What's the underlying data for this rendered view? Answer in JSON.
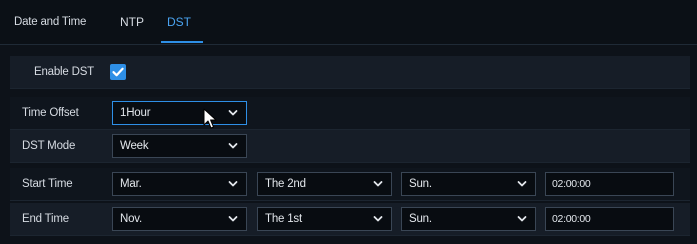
{
  "tabs": [
    {
      "label": "Date and Time",
      "active": false
    },
    {
      "label": "NTP",
      "active": false
    },
    {
      "label": "DST",
      "active": true
    }
  ],
  "accent_color": "#2e8fe6",
  "form": {
    "enable_dst": {
      "label": "Enable DST",
      "checked": true
    },
    "time_offset": {
      "label": "Time Offset",
      "value": "1Hour"
    },
    "dst_mode": {
      "label": "DST Mode",
      "value": "Week"
    },
    "start_time": {
      "label": "Start Time",
      "month": "Mar.",
      "week": "The 2nd",
      "day": "Sun.",
      "time": "02:00:00"
    },
    "end_time": {
      "label": "End Time",
      "month": "Nov.",
      "week": "The 1st",
      "day": "Sun.",
      "time": "02:00:00"
    }
  },
  "icons": {
    "dropdown": "chevron-down-icon",
    "checkbox": "checkmark-icon",
    "pointer": "mouse-pointer-icon"
  }
}
